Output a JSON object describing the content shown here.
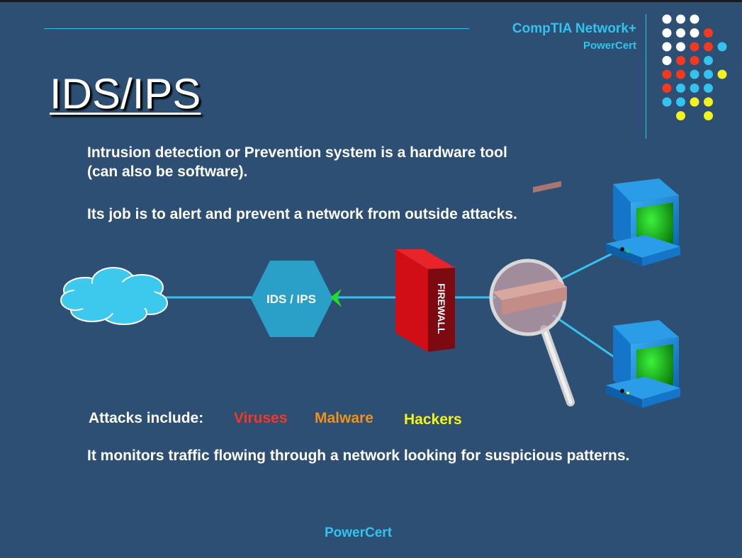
{
  "header": {
    "brand_line1": "CompTIA Network+",
    "brand_line2": "PowerCert"
  },
  "slide": {
    "title": "IDS/IPS",
    "paragraph1": "Intrusion detection or Prevention system is a hardware tool (can also be software).",
    "paragraph2": "Its job is to alert and prevent a network from outside attacks.",
    "attacks_label": "Attacks include:",
    "attack_types": [
      "Viruses",
      "Malware",
      "Hackers"
    ],
    "paragraph3": "It monitors traffic flowing through a network looking for suspicious patterns.",
    "footer": "PowerCert"
  },
  "diagram": {
    "ids_label": "IDS / IPS",
    "firewall_label": "FIREWALL"
  },
  "colors": {
    "background": "#2d4f73",
    "accent": "#33c3ee",
    "virus": "#f5391e",
    "malware": "#f1901f",
    "hackers": "#f5f21e",
    "firewall": "#c40c14",
    "ids_hexagon": "#2aa0c8",
    "monitor_screen": "#1cb31c"
  },
  "decoration_dot_colors": [
    [
      "#ffffff",
      "#ffffff",
      "#ffffff",
      null,
      null
    ],
    [
      "#ffffff",
      "#ffffff",
      "#ffffff",
      "#f5391e",
      null
    ],
    [
      "#ffffff",
      "#ffffff",
      "#f5391e",
      "#f5391e",
      "#33c3ee"
    ],
    [
      "#ffffff",
      "#f5391e",
      "#f5391e",
      "#33c3ee",
      null
    ],
    [
      "#f5391e",
      "#f5391e",
      "#33c3ee",
      "#33c3ee",
      "#f5f21e"
    ],
    [
      "#f5391e",
      "#33c3ee",
      "#33c3ee",
      "#33c3ee",
      null
    ],
    [
      "#33c3ee",
      "#33c3ee",
      "#f5f21e",
      "#f5f21e",
      null
    ],
    [
      null,
      "#f5f21e",
      null,
      "#f5f21e",
      null
    ]
  ]
}
